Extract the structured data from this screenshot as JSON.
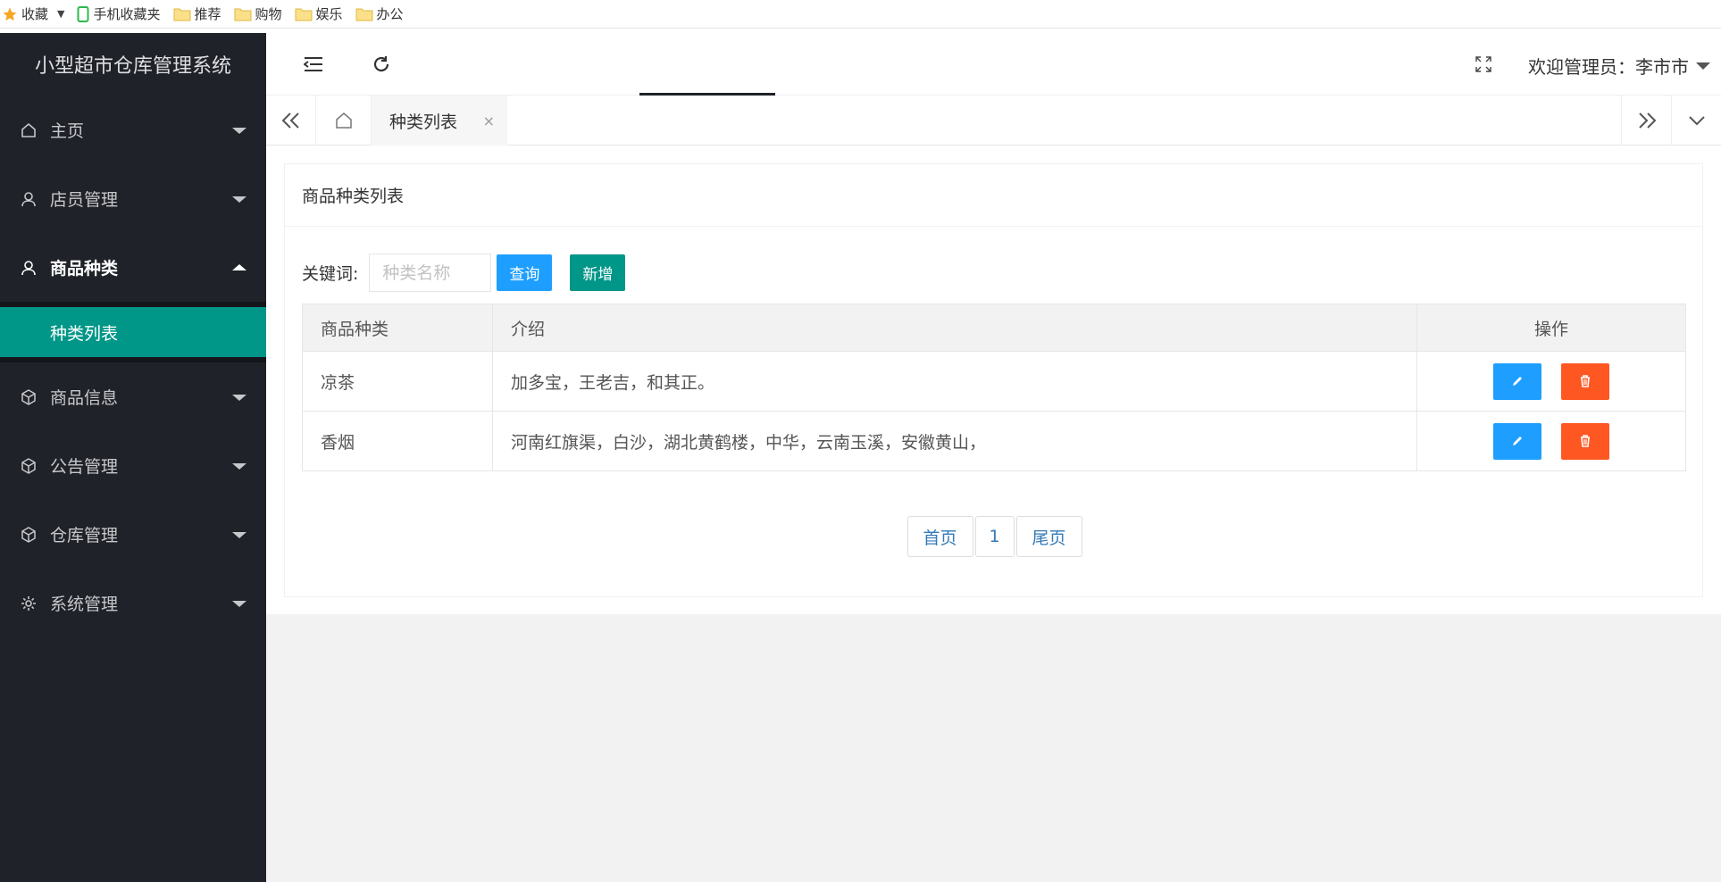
{
  "bookmarks": {
    "items": [
      "收藏",
      "手机收藏夹",
      "推荐",
      "购物",
      "娱乐",
      "办公"
    ]
  },
  "app": {
    "title": "小型超市仓库管理系统",
    "welcome": "欢迎管理员：李市市"
  },
  "sidebar": {
    "items": [
      {
        "label": "主页",
        "icon": "home-icon"
      },
      {
        "label": "店员管理",
        "icon": "user-icon"
      },
      {
        "label": "商品种类",
        "icon": "user-icon"
      },
      {
        "label": "商品信息",
        "icon": "cube-icon"
      },
      {
        "label": "公告管理",
        "icon": "cube-icon"
      },
      {
        "label": "仓库管理",
        "icon": "cube-icon"
      },
      {
        "label": "系统管理",
        "icon": "gear-icon"
      }
    ],
    "sub_item": "种类列表"
  },
  "tabs": {
    "active": "种类列表",
    "close": "×"
  },
  "card": {
    "title": "商品种类列表"
  },
  "search": {
    "label": "关键词:",
    "placeholder": "种类名称",
    "query_label": "查询",
    "add_label": "新增"
  },
  "table": {
    "headers": [
      "商品种类",
      "介绍",
      "操作"
    ],
    "rows": [
      {
        "name": "凉茶",
        "desc": "加多宝，王老吉，和其正。"
      },
      {
        "name": "香烟",
        "desc": "河南红旗渠，白沙，湖北黄鹤楼，中华，云南玉溪，安徽黄山，"
      }
    ]
  },
  "pagination": {
    "first": "首页",
    "page": "1",
    "last": "尾页"
  },
  "colors": {
    "sidebar_bg": "#20222a",
    "accent_green": "#009688",
    "accent_blue": "#1e9fff",
    "danger": "#ff5722"
  }
}
